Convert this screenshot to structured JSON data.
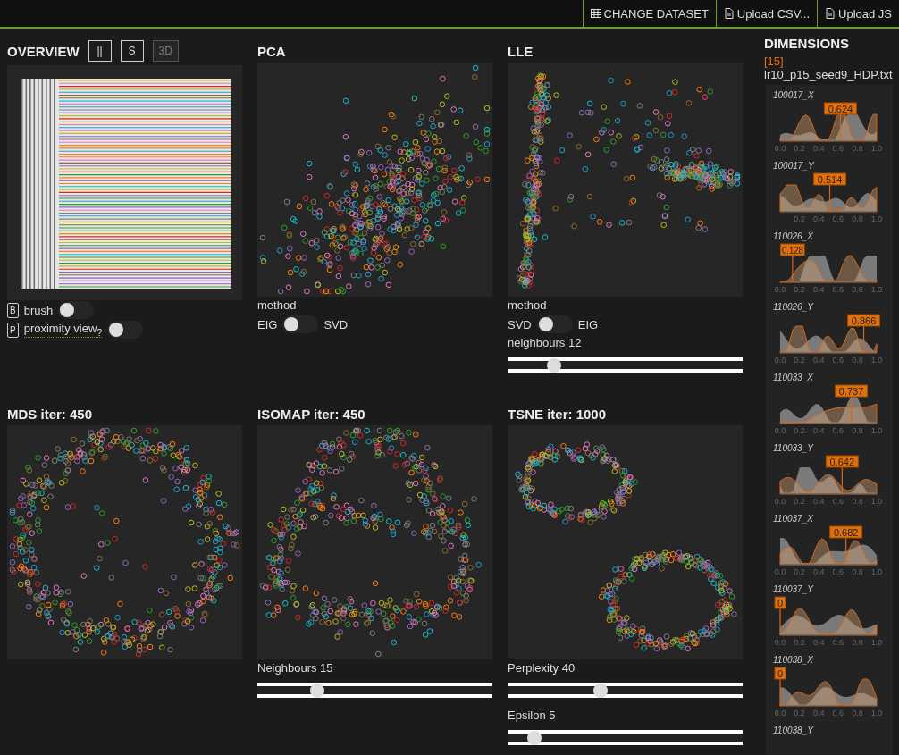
{
  "toolbar": {
    "buttons": [
      {
        "kind": "dataset",
        "label": "CHANGE DATASET"
      },
      {
        "kind": "upload",
        "label": "Upload CSV..."
      },
      {
        "kind": "upload",
        "label": "Upload JS"
      }
    ]
  },
  "overview": {
    "title": "OVERVIEW",
    "buttons": [
      {
        "label": "||",
        "disabled": false
      },
      {
        "label": "S",
        "disabled": false
      },
      {
        "label": "3D",
        "disabled": true
      }
    ],
    "options": [
      {
        "key": "B",
        "label": "brush",
        "on": false
      },
      {
        "key": "P",
        "label": "proximity view$_{?}$",
        "on": false
      }
    ]
  },
  "projections": [
    {
      "title": "PCA",
      "kind": "cloud",
      "controls": [
        {
          "kind": "label",
          "text": "method"
        },
        {
          "kind": "switch",
          "left": "EIG",
          "right": "SVD",
          "on": false
        }
      ]
    },
    {
      "title": "LLE",
      "kind": "arms",
      "controls": [
        {
          "kind": "label",
          "text": "method"
        },
        {
          "kind": "switch",
          "left": "SVD",
          "right": "EIG",
          "on": false
        },
        {
          "kind": "slider",
          "label": "neighbours 12",
          "level": 0.18
        }
      ]
    },
    {
      "title": "MDS iter: 450",
      "kind": "ring"
    },
    {
      "title": "ISOMAP iter: 450",
      "kind": "loops",
      "controls": [
        {
          "kind": "slider",
          "label": "Neighbours 15",
          "level": 0.24
        }
      ]
    },
    {
      "title": "TSNE iter: 1000",
      "kind": "rings",
      "controls": [
        {
          "kind": "slider",
          "label": "Perplexity 40",
          "level": 0.39
        },
        {
          "kind": "slider",
          "label": "Epsilon 5",
          "level": 0.09
        }
      ]
    }
  ],
  "dimensions": {
    "title": "DIMENSIONS",
    "count": "[15]",
    "file": "lr10_p15_seed9_HDP.txt",
    "items": [
      {
        "name": "100017_X",
        "value": "0.624",
        "level": 0.624,
        "ticks": [
          "0.0",
          "0.2",
          "0.4",
          "0.6",
          "0.8",
          "1.0"
        ]
      },
      {
        "name": "100017_Y",
        "value": "0.514",
        "level": 0.514,
        "ticks": [
          "0.2",
          "0.4",
          "0.6",
          "0.8",
          "1.0"
        ]
      },
      {
        "name": "110026_X",
        "value": "0.128",
        "level": 0.128,
        "ticks": [
          "0.0",
          "0.2",
          "0.4",
          "0.6",
          "0.8",
          "1.0"
        ]
      },
      {
        "name": "110026_Y",
        "value": "0.866",
        "level": 0.866,
        "ticks": [
          "0.0",
          "0.2",
          "0.4",
          "0.6",
          "0.8",
          "1.0"
        ]
      },
      {
        "name": "110033_X",
        "value": "0.737",
        "level": 0.737,
        "ticks": [
          "0.0",
          "0.2",
          "0.4",
          "0.6",
          "0.8",
          "1.0"
        ]
      },
      {
        "name": "110033_Y",
        "value": "0.642",
        "level": 0.642,
        "ticks": [
          "0.0",
          "0.2",
          "0.4",
          "0.6",
          "0.8",
          "1.0"
        ]
      },
      {
        "name": "110037_X",
        "value": "0.682",
        "level": 0.682,
        "ticks": [
          "0.0",
          "0.2",
          "0.4",
          "0.6",
          "0.8",
          "1.0"
        ]
      },
      {
        "name": "110037_Y",
        "value": "0",
        "level": 0,
        "ticks": [
          "0.0",
          "0.2",
          "0.4",
          "0.6",
          "0.8",
          "1.0"
        ]
      },
      {
        "name": "110038_X",
        "value": "0",
        "level": 0,
        "ticks": [
          "0.0",
          "0.2",
          "0.4",
          "0.6",
          "0.8",
          "1.0"
        ]
      },
      {
        "name": "110038_Y"
      }
    ]
  }
}
